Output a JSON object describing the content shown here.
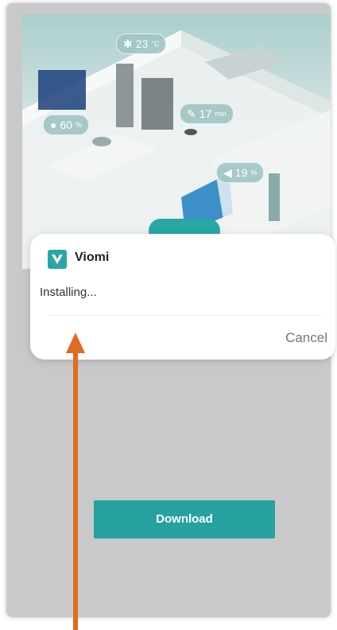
{
  "hero": {
    "bubbles": [
      {
        "icon": "snowflake-icon",
        "value": "23",
        "unit": "°C"
      },
      {
        "icon": "bulb-icon",
        "value": "60",
        "unit": "%"
      },
      {
        "icon": "broom-icon",
        "value": "17",
        "unit": "min"
      },
      {
        "icon": "speaker-icon",
        "value": "19",
        "unit": "%"
      }
    ]
  },
  "dialog": {
    "app_name": "Viomi",
    "status": "Installing...",
    "cancel_label": "Cancel"
  },
  "download_label": "Download",
  "colors": {
    "accent": "#27a19f",
    "annotation_arrow": "#e06b22",
    "backdrop": "#c9c9cc"
  }
}
